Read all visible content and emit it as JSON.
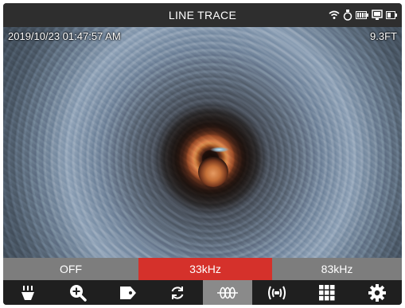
{
  "header": {
    "title": "LINE TRACE",
    "status_icons": [
      "wifi-icon",
      "sonde-icon",
      "battery-icon",
      "monitor-icon",
      "battery-small-icon"
    ]
  },
  "viewport": {
    "timestamp": "2019/10/23 01:47:57 AM",
    "distance": "9.3FT"
  },
  "frequency": {
    "options": [
      {
        "label": "OFF",
        "active": false
      },
      {
        "label": "33kHz",
        "active": true
      },
      {
        "label": "83kHz",
        "active": false
      }
    ],
    "active_color": "#d5312b",
    "inactive_color": "#7d7d7d"
  },
  "toolbar": {
    "tools": [
      {
        "icon": "light-icon",
        "active": false
      },
      {
        "icon": "zoom-in-icon",
        "active": false
      },
      {
        "icon": "tag-icon",
        "active": false
      },
      {
        "icon": "rotate-icon",
        "active": false
      },
      {
        "icon": "line-trace-icon",
        "active": true
      },
      {
        "icon": "sonde-transmit-icon",
        "active": false
      },
      {
        "icon": "grid-icon",
        "active": false
      },
      {
        "icon": "settings-icon",
        "active": false
      }
    ],
    "active_color": "#8a8a8a"
  }
}
